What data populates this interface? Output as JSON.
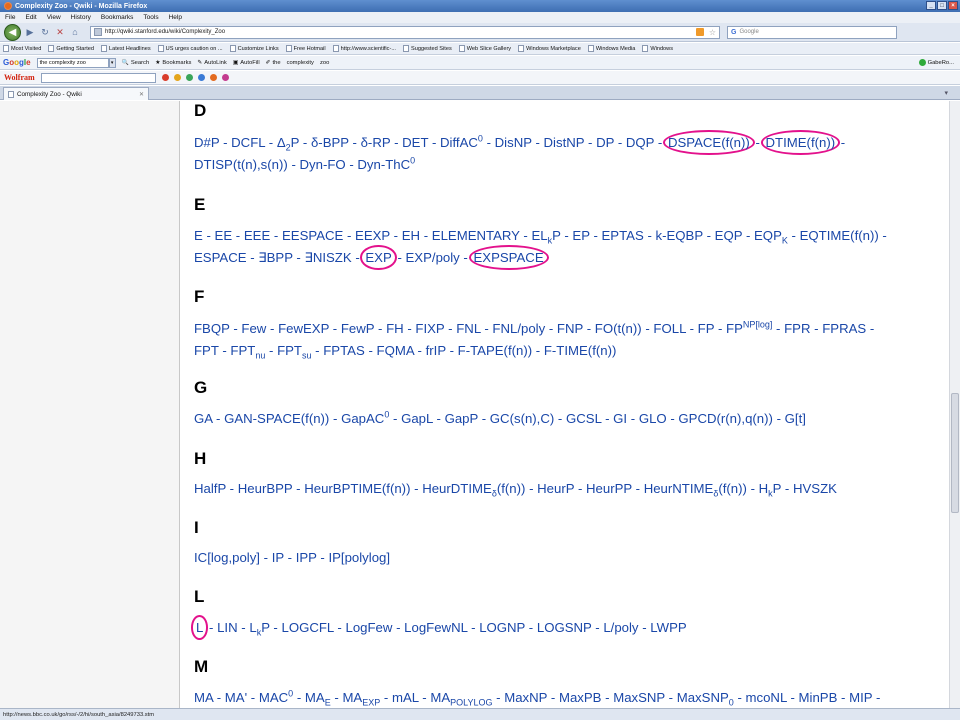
{
  "window": {
    "title": "Complexity Zoo - Qwiki - Mozilla Firefox"
  },
  "menu": [
    "File",
    "Edit",
    "View",
    "History",
    "Bookmarks",
    "Tools",
    "Help"
  ],
  "nav": {
    "url": "http://qwiki.stanford.edu/wiki/Complexity_Zoo",
    "search_placeholder": "Google"
  },
  "bookmarks": [
    "Most Visited",
    "Getting Started",
    "Latest Headlines",
    "US urges caution on ...",
    "Customize Links",
    "Free Hotmail",
    "http://www.scientific-...",
    "Suggested Sites",
    "Web Slice Gallery",
    "Windows Marketplace",
    "Windows Media",
    "Windows"
  ],
  "google_toolbar": {
    "query": "the complexity zoo",
    "search": "Search",
    "bookmarks": "Bookmarks",
    "autolink": "AutoLink",
    "autofill": "AutoFill",
    "term1": "the",
    "term2": "complexity",
    "term3": "zoo",
    "user": "GabeRo..."
  },
  "wolfram": {
    "label": "Wolfram"
  },
  "tab": {
    "title": "Complexity Zoo - Qwiki"
  },
  "sections": {
    "D": "D",
    "E": "E",
    "F": "F",
    "G": "G",
    "H": "H",
    "I": "I",
    "L": "L",
    "M": "M"
  },
  "status": {
    "text": "http://news.bbc.co.uk/go/rss/-/2/hi/south_asia/8249733.stm"
  },
  "colors": {
    "link": "#1a47a8",
    "highlight_circle": "#e3118c"
  }
}
